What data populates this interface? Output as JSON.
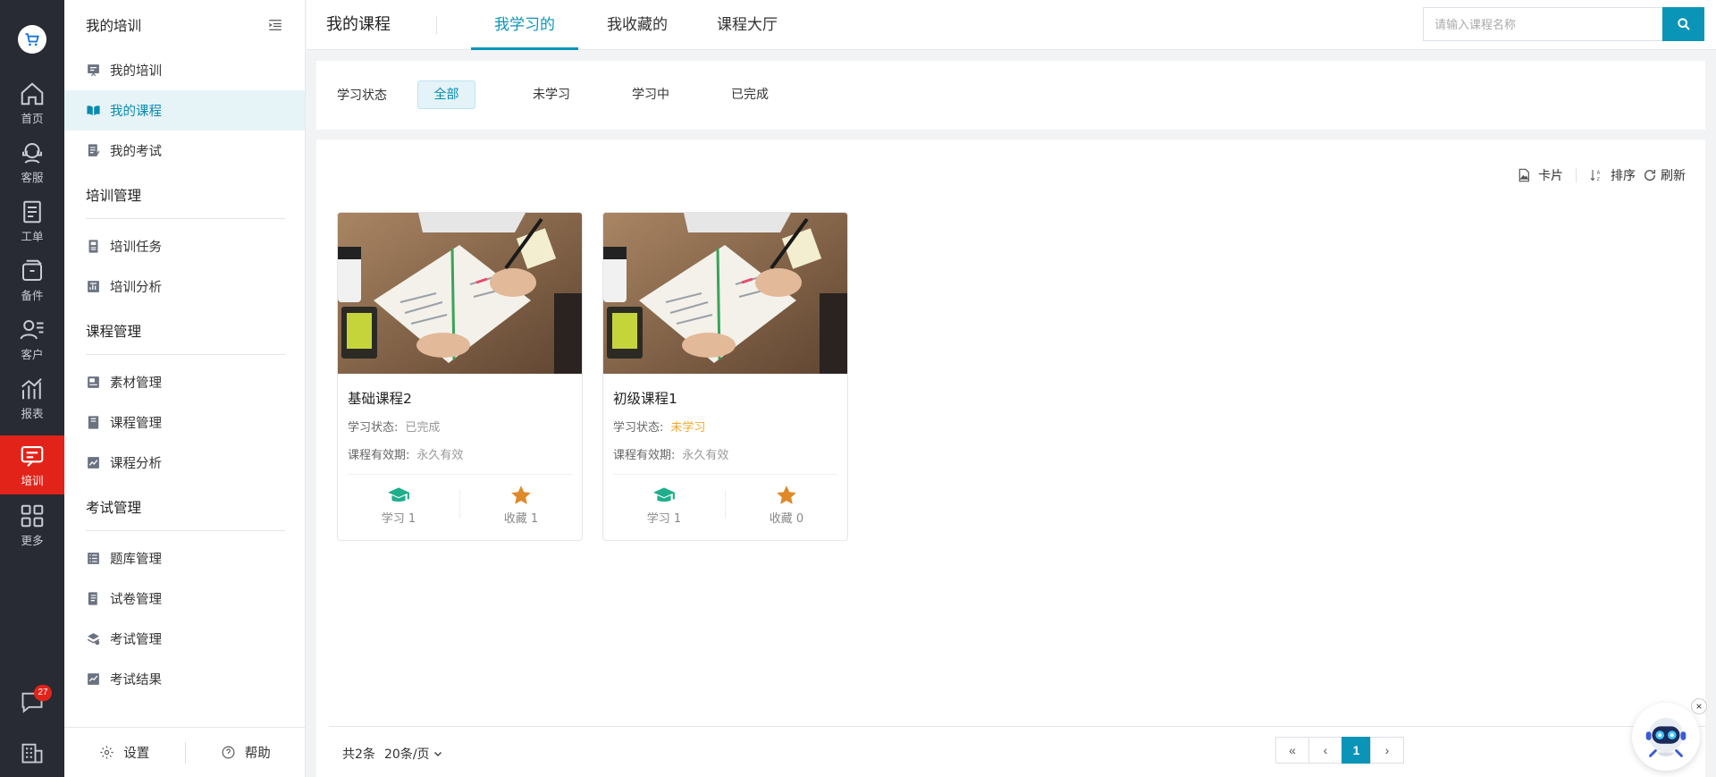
{
  "rail": {
    "logo_icon": "shopping-cart-icon",
    "items": [
      {
        "label": "首页",
        "icon": "home-icon"
      },
      {
        "label": "客服",
        "icon": "headset-icon"
      },
      {
        "label": "工单",
        "icon": "clipboard-icon"
      },
      {
        "label": "备件",
        "icon": "box-icon"
      },
      {
        "label": "客户",
        "icon": "customer-icon"
      },
      {
        "label": "报表",
        "icon": "chart-icon"
      },
      {
        "label": "培训",
        "icon": "training-chat-icon",
        "active": true
      },
      {
        "label": "更多",
        "icon": "grid-icon"
      }
    ],
    "chat_badge": "27",
    "accent": "#e2231a"
  },
  "menu": {
    "header": "我的培训",
    "items_top": [
      {
        "label": "我的培训",
        "icon": "chalkboard-icon"
      },
      {
        "label": "我的课程",
        "icon": "open-book-icon",
        "active": true
      },
      {
        "label": "我的考试",
        "icon": "exam-paper-icon"
      }
    ],
    "group_training": "培训管理",
    "items_training": [
      {
        "label": "培训任务",
        "icon": "task-book-icon"
      },
      {
        "label": "培训分析",
        "icon": "analysis-sheet-icon"
      }
    ],
    "group_course": "课程管理",
    "items_course": [
      {
        "label": "素材管理",
        "icon": "material-icon"
      },
      {
        "label": "课程管理",
        "icon": "course-book-icon"
      },
      {
        "label": "课程分析",
        "icon": "line-chart-icon"
      }
    ],
    "group_exam": "考试管理",
    "items_exam": [
      {
        "label": "题库管理",
        "icon": "question-bank-icon"
      },
      {
        "label": "试卷管理",
        "icon": "test-paper-icon"
      },
      {
        "label": "考试管理",
        "icon": "stack-icon"
      },
      {
        "label": "考试结果",
        "icon": "result-chart-icon"
      }
    ],
    "footer": {
      "settings": "设置",
      "help": "帮助"
    }
  },
  "topbar": {
    "title": "我的课程",
    "tabs": [
      {
        "label": "我学习的",
        "active": true
      },
      {
        "label": "我收藏的"
      },
      {
        "label": "课程大厅"
      }
    ],
    "search_placeholder": "请输入课程名称",
    "accent": "#0a95b8"
  },
  "filter": {
    "label": "学习状态",
    "options": [
      {
        "label": "全部",
        "active": true
      },
      {
        "label": "未学习"
      },
      {
        "label": "学习中"
      },
      {
        "label": "已完成"
      }
    ]
  },
  "toolbar": {
    "card": "卡片",
    "sort": "排序",
    "refresh": "刷新"
  },
  "courses": [
    {
      "title": "基础课程2",
      "status_label": "学习状态:",
      "status": "已完成",
      "validity_label": "课程有效期:",
      "validity": "永久有效",
      "study": "学习 1",
      "favorite": "收藏 1"
    },
    {
      "title": "初级课程1",
      "status_label": "学习状态:",
      "status": "未学习",
      "validity_label": "课程有效期:",
      "validity": "永久有效",
      "study": "学习 1",
      "favorite": "收藏 0"
    }
  ],
  "pagination": {
    "total": "共2条",
    "page_size": "20条/页",
    "current_page": "1",
    "first": "«",
    "prev": "‹",
    "next": "›"
  },
  "assistant": {
    "icon": "robot-assistant-icon",
    "close": "×"
  }
}
